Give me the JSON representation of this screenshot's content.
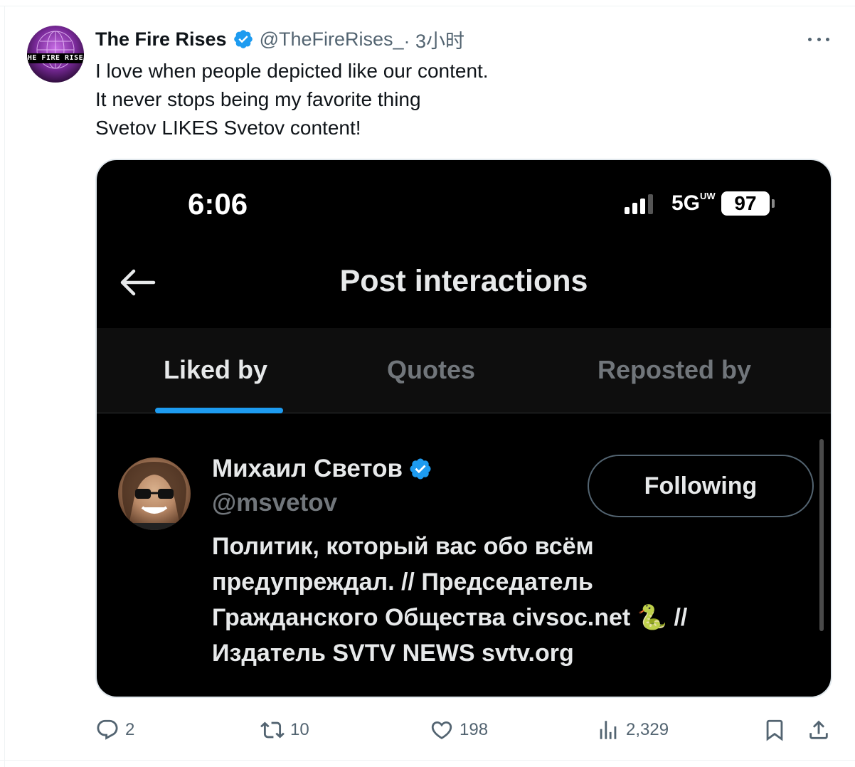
{
  "tweet": {
    "author": {
      "display_name": "The Fire Rises",
      "handle": "@TheFireRises_",
      "time": " · 3小时",
      "avatar_text": "THE FIRE RISES",
      "verified_icon": "verified-badge-icon"
    },
    "text_lines": [
      "I love when people depicted like our content.",
      "It never stops being my favorite thing",
      "Svetov LIKES Svetov content!"
    ],
    "more_icon": "more-horizontal-icon"
  },
  "screenshot": {
    "status_bar": {
      "time": "6:06",
      "network": "5G",
      "network_suffix": "UW",
      "battery": "97"
    },
    "title": "Post interactions",
    "tabs": [
      {
        "label": "Liked by",
        "active": true
      },
      {
        "label": "Quotes",
        "active": false
      },
      {
        "label": "Reposted by",
        "active": false
      }
    ],
    "user": {
      "name": "Михаил Светов",
      "handle": "@msvetov",
      "follow_label": "Following",
      "bio_lines": [
        "Политик, который вас обо всём",
        "предупреждал. // Председатель",
        "Гражданского Общества civsoc.net 🐍 //",
        "Издатель SVTV NEWS svtv.org"
      ]
    }
  },
  "actions": {
    "replies": "2",
    "reposts": "10",
    "likes": "198",
    "views": "2,329"
  },
  "colors": {
    "accent": "#1d9bf0",
    "text": "#0f1419",
    "secondary": "#536471"
  }
}
